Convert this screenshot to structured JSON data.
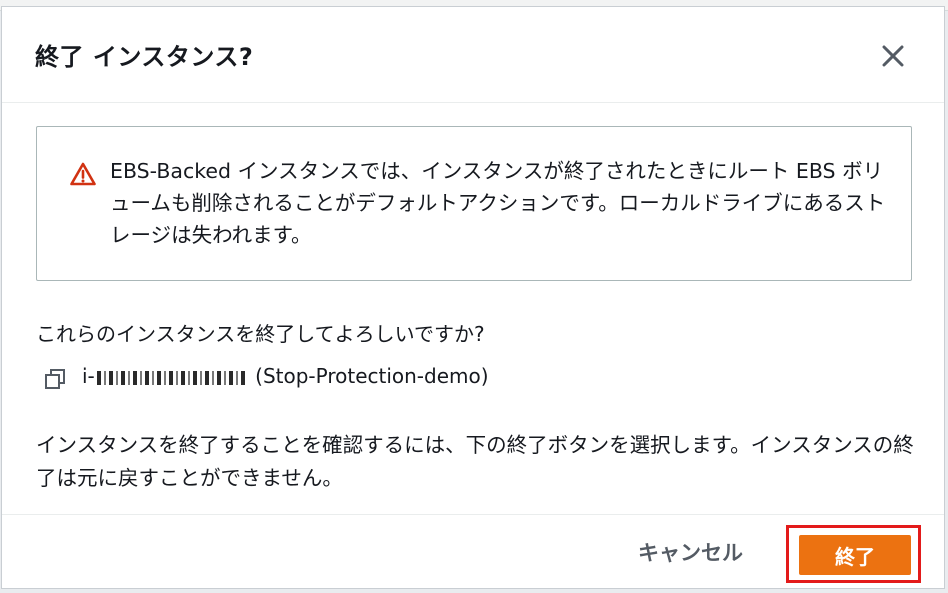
{
  "modal": {
    "title": "終了 インスタンス?",
    "warning": {
      "icon": "warning-triangle-icon",
      "icon_color": "#d13212",
      "text": "EBS-Backed インスタンスでは、インスタンスが終了されたときにルート EBS ボリュームも削除されることがデフォルトアクションです。ローカルドライブにあるストレージは失われます。"
    },
    "question": "これらのインスタンスを終了してよろしいですか?",
    "instance": {
      "id_prefix": "i-",
      "name": "(Stop-Protection-demo)"
    },
    "confirm_text": "インスタンスを終了することを確認するには、下の終了ボタンを選択します。インスタンスの終了は元に戻すことができません。",
    "footer": {
      "cancel_label": "キャンセル",
      "terminate_label": "終了",
      "terminate_color": "#ec7211",
      "highlight_color": "#e31a1a"
    }
  }
}
